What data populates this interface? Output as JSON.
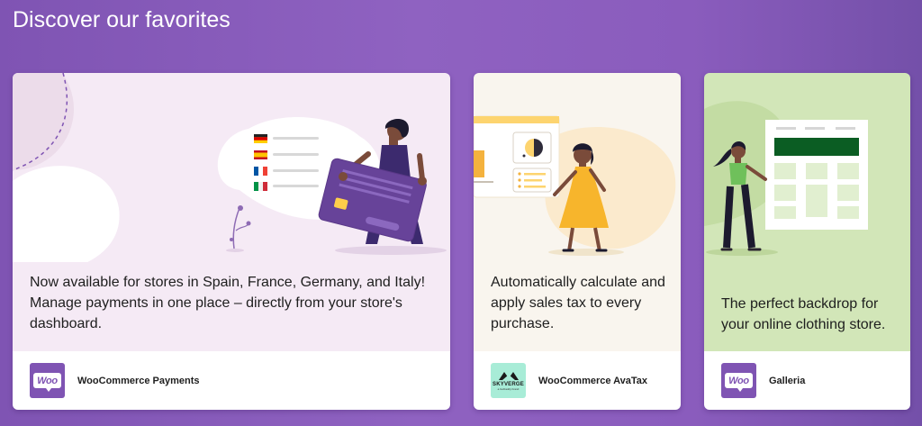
{
  "section": {
    "title": "Discover our favorites"
  },
  "colors": {
    "background": "#8f62c1",
    "brand_purple": "#7f54b3",
    "card1_bg": "#f5eaf5",
    "card2_bg": "#f9f5ee",
    "card3_bg": "#d2e6b8",
    "skyverge_bg": "#a8ecd7"
  },
  "cards": [
    {
      "description": "Now available for stores in Spain, France, Germany, and Italy! Manage payments in one place – directly from your store's dashboard.",
      "name": "WooCommerce Payments",
      "logo_icon": "woo-logo",
      "logo_text": "Woo",
      "illustration": "woman-holding-credit-card-with-country-flags"
    },
    {
      "description": "Automatically calculate and apply sales tax to every purchase.",
      "name": "WooCommerce AvaTax",
      "logo_icon": "skyverge-logo",
      "logo_text": "SKYVERGE",
      "logo_subtext": "a GoDaddy brand",
      "illustration": "woman-with-dashboard-charts"
    },
    {
      "description": "The perfect backdrop for your online clothing store.",
      "name": "Galleria",
      "logo_icon": "woo-logo",
      "logo_text": "Woo",
      "illustration": "woman-pointing-at-storefront-layout"
    }
  ]
}
